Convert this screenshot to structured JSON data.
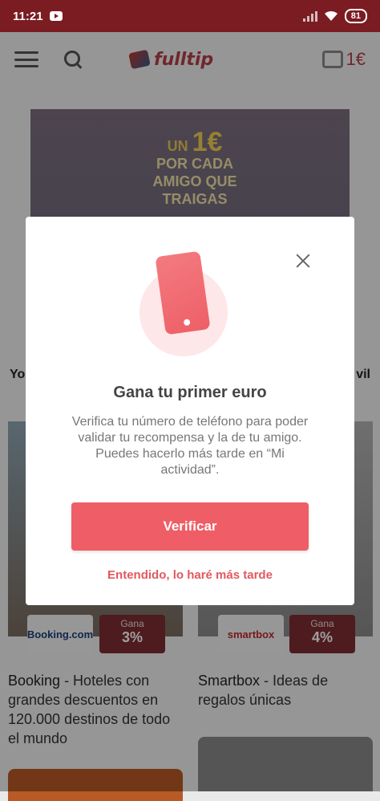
{
  "status_bar": {
    "time": "11:21",
    "battery": "81"
  },
  "header": {
    "logo_text": "fulltip",
    "wallet_amount": "1€"
  },
  "banner": {
    "line1": "UN",
    "amount": "1€",
    "line2": "POR CADA",
    "line3": "AMIGO QUE",
    "line4": "TRAIGAS"
  },
  "behind": {
    "left_partial": "Yo",
    "right_partial": "vil"
  },
  "cards": [
    {
      "brand": "Booking.com",
      "gana_label": "Gana",
      "percent": "3%",
      "name": "Booking",
      "desc": " - Hoteles con grandes descuentos en 120.000 destinos de todo el mundo"
    },
    {
      "brand": "smartbox",
      "gana_label": "Gana",
      "percent": "4%",
      "name": "Smartbox",
      "desc": " - Ideas de regalos únicas"
    }
  ],
  "modal": {
    "title": "Gana tu primer euro",
    "text": "Verifica tu número de teléfono para poder validar tu recompensa y la de tu amigo. Puedes hacerlo más tarde en “Mi actividad”.",
    "verify_label": "Verificar",
    "later_label": "Entendido, lo haré más tarde"
  },
  "colors": {
    "accent": "#ef5e66",
    "link": "#e2585f",
    "status_bar": "#7a1c22"
  }
}
